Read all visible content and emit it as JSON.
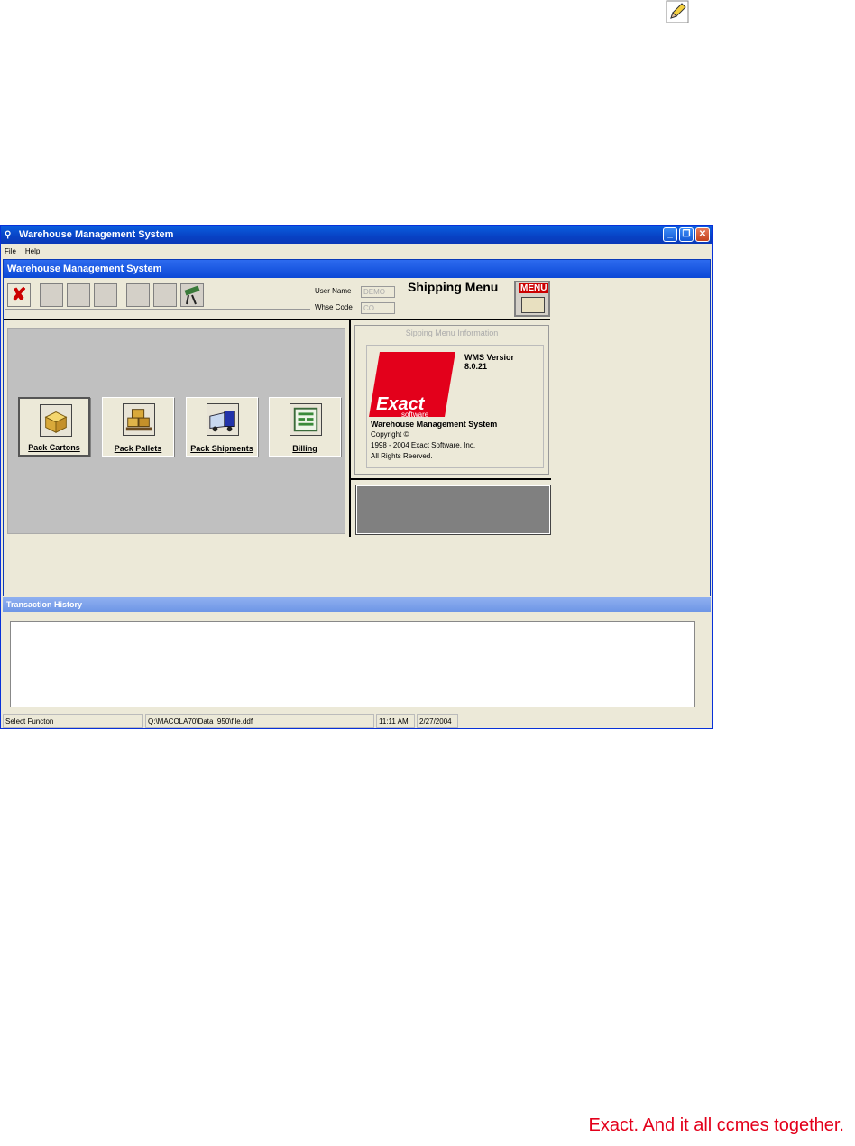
{
  "window": {
    "title": "Warehouse Management System",
    "minimize": "_",
    "restore": "❐",
    "close": "✕"
  },
  "menubar": {
    "file": "File",
    "help": "Help"
  },
  "inner": {
    "title": "Warehouse Management System",
    "user_name_label": "User Name",
    "user_name_value": "DEMO",
    "whse_code_label": "Whse Code",
    "whse_code_value": "CO",
    "menu_title": "Shipping Menu",
    "menu_icon_text": "MENU"
  },
  "toolbar": {
    "close_glyph": "✘"
  },
  "buttons": [
    {
      "label": "Pack Cartons"
    },
    {
      "label": "Pack Pallets"
    },
    {
      "label": "Pack Shipments"
    },
    {
      "label": "Billing"
    }
  ],
  "info": {
    "heading": "Sipping Menu Information",
    "version_label": "WMS Versior",
    "version": "8.0.21",
    "logo_main": "Exact",
    "logo_sub": "software",
    "product": "Warehouse Management System",
    "copyright": "Copyright ©",
    "years": "1998 - 2004 Exact Software, Inc.",
    "rights": "All Rights Reerved."
  },
  "transaction": {
    "title": "Transaction History"
  },
  "status": {
    "message": "Select Functon",
    "path": "Q:\\MACOLA70\\Data_950\\file.ddf",
    "time": "11:11 AM",
    "date": "2/27/2004"
  },
  "slogan": "Exact. And it all ccmes together."
}
